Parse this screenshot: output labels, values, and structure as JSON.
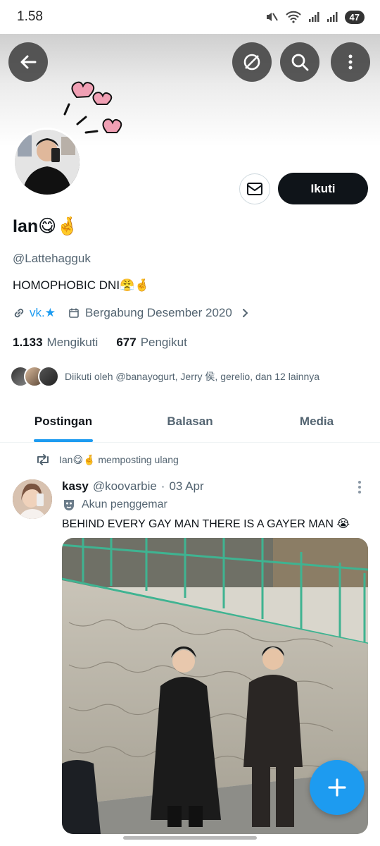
{
  "status_bar": {
    "time": "1.58",
    "battery": "47"
  },
  "header": {
    "back_icon": "arrow-left-icon",
    "icons": [
      "no-signal-icon",
      "search-icon",
      "more-vertical-icon"
    ]
  },
  "profile": {
    "display_name": "Ian😋🤞",
    "handle": "@Lattehagguk",
    "bio": "HOMOPHOBIC DNI😤🤞",
    "website": "vk.★",
    "joined": "Bergabung Desember 2020",
    "following_count": "1.133",
    "following_label": "Mengikuti",
    "followers_count": "677",
    "followers_label": "Pengikut",
    "followed_by": "Diikuti oleh @banayogurt, Jerry 侯, gerelio, dan 12 lainnya",
    "follow_button": "Ikuti"
  },
  "tabs": [
    {
      "label": "Postingan",
      "active": true
    },
    {
      "label": "Balasan",
      "active": false
    },
    {
      "label": "Media",
      "active": false
    }
  ],
  "post": {
    "repost_by": "Ian😋🤞",
    "repost_text": "memposting ulang",
    "author_name": "kasy",
    "author_handle": "@koovarbie",
    "separator": "·",
    "date": "03 Apr",
    "fan_label": "Akun penggemar",
    "text": "BEHIND EVERY GAY MAN THERE IS A GAYER MAN 😭"
  },
  "colors": {
    "accent": "#1d9bf0",
    "text": "#0f1419",
    "muted": "#536471",
    "follow_button_bg": "#0f1419"
  }
}
